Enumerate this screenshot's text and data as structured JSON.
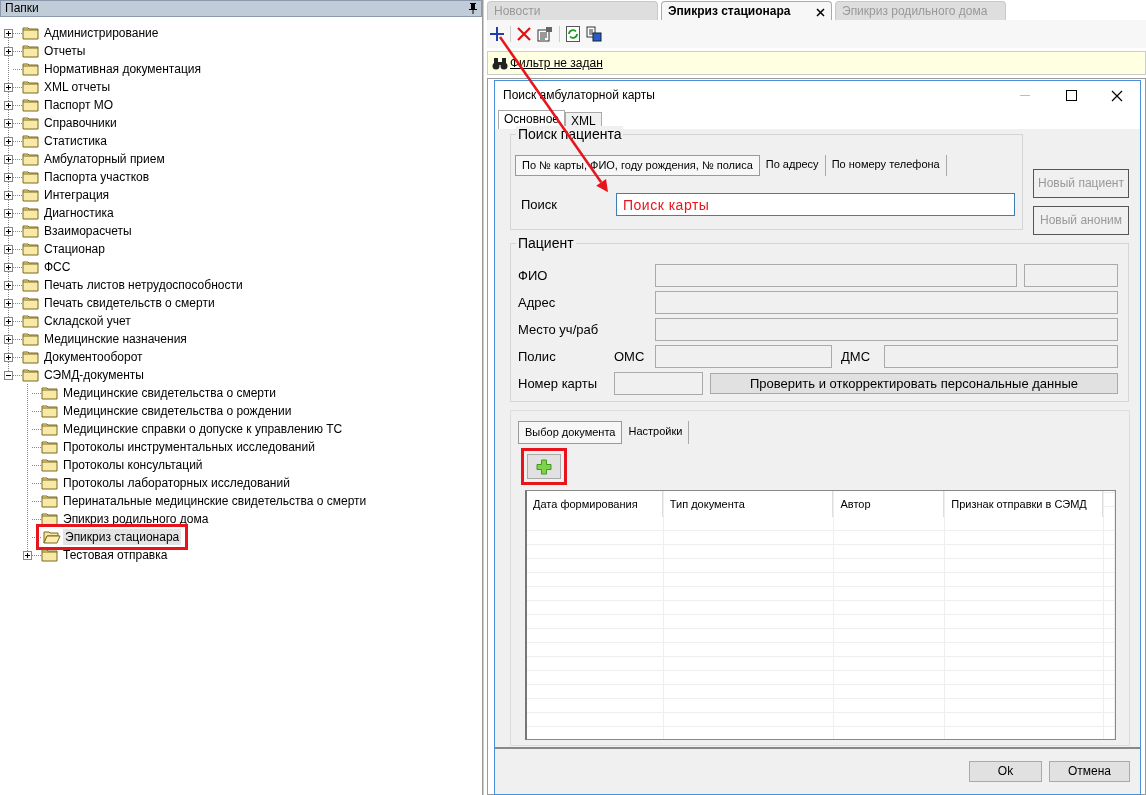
{
  "folders_panel": {
    "title": "Папки"
  },
  "tree": [
    {
      "label": "Администрирование",
      "expanded": false,
      "selected": false
    },
    {
      "label": "Отчеты",
      "expanded": false,
      "selected": false
    },
    {
      "label": "Нормативная документация",
      "selected": false
    },
    {
      "label": "XML отчеты",
      "expanded": false,
      "selected": false
    },
    {
      "label": "Паспорт МО",
      "expanded": false,
      "selected": false
    },
    {
      "label": "Справочники",
      "expanded": false,
      "selected": false
    },
    {
      "label": "Статистика",
      "expanded": false,
      "selected": false
    },
    {
      "label": "Амбулаторный прием",
      "expanded": false,
      "selected": false
    },
    {
      "label": "Паспорта участков",
      "expanded": false,
      "selected": false
    },
    {
      "label": "Интеграция",
      "expanded": false,
      "selected": false
    },
    {
      "label": "Диагностика",
      "expanded": false,
      "selected": false
    },
    {
      "label": "Взаиморасчеты",
      "expanded": false,
      "selected": false
    },
    {
      "label": "Стационар",
      "expanded": false,
      "selected": false
    },
    {
      "label": "ФСС",
      "expanded": false,
      "selected": false
    },
    {
      "label": "Печать листов нетрудоспособности",
      "expanded": false,
      "selected": false
    },
    {
      "label": "Печать свидетельств о смерти",
      "expanded": false,
      "selected": false
    },
    {
      "label": "Складской учет",
      "expanded": false,
      "selected": false
    },
    {
      "label": "Медицинские назначения",
      "expanded": false,
      "selected": false
    },
    {
      "label": "Документооборот",
      "expanded": false,
      "selected": false
    },
    {
      "label": "СЭМД-документы",
      "expanded": true,
      "selected": false,
      "children": [
        {
          "label": "Медицинские свидетельства о смерти",
          "selected": false
        },
        {
          "label": "Медицинские свидетельства о рождении",
          "selected": false
        },
        {
          "label": "Медицинские справки о допуске к управлению ТС",
          "selected": false
        },
        {
          "label": "Протоколы инструментальных исследований",
          "selected": false
        },
        {
          "label": "Протоколы консультаций",
          "selected": false
        },
        {
          "label": "Протоколы лабораторных исследований",
          "selected": false
        },
        {
          "label": "Перинатальные медицинские свидетельства о смерти",
          "selected": false
        },
        {
          "label": "Эпикриз родильного дома",
          "selected": false
        },
        {
          "label": "Эпикриз стационара",
          "selected": true,
          "highlighted": true
        },
        {
          "label": "Тестовая отправка",
          "expanded": false,
          "selected": false
        }
      ]
    }
  ],
  "document_tabs": [
    {
      "label": "Новости",
      "selected": false,
      "closable": false
    },
    {
      "label": "Эпикриз стационара",
      "selected": true,
      "closable": true
    },
    {
      "label": "Эпикриз родильного дома",
      "selected": false,
      "closable": false
    }
  ],
  "filter": {
    "link": "Фильтр не задан"
  },
  "dialog": {
    "title": "Поиск амбулаторной карты",
    "tabs": [
      {
        "label": "Основное",
        "selected": true
      },
      {
        "label": "XML",
        "selected": false
      }
    ],
    "patient_search": {
      "title": "Поиск пациента",
      "tabs": [
        {
          "label": "По № карты, ФИО, году рождения, № полиса",
          "selected": true
        },
        {
          "label": "По адресу",
          "selected": false
        },
        {
          "label": "По номеру телефона",
          "selected": false
        }
      ],
      "search_label": "Поиск",
      "search_value": "Поиск карты",
      "buttons": [
        {
          "label": "Новый пациент",
          "disabled": true
        },
        {
          "label": "Новый аноним",
          "disabled": true
        }
      ]
    },
    "patient": {
      "title": "Пациент",
      "disabled": true,
      "fio_label": "ФИО",
      "address_label": "Адрес",
      "workplace_label": "Место уч/раб",
      "policy_label": "Полис",
      "oms_label": "ОМС",
      "dms_label": "ДМС",
      "card_label": "Номер карты",
      "check_button": "Проверить и откорректировать персональные данные"
    },
    "document_tabs": [
      {
        "label": "Выбор документа",
        "selected": true
      },
      {
        "label": "Настройки",
        "selected": false
      }
    ],
    "add_button": {
      "highlighted": true
    },
    "table": {
      "columns": [
        "Дата формирования",
        "Тип документа",
        "Автор",
        "Признак отправки в СЭМД"
      ]
    },
    "buttons": [
      "Ok",
      "Отмена"
    ]
  }
}
